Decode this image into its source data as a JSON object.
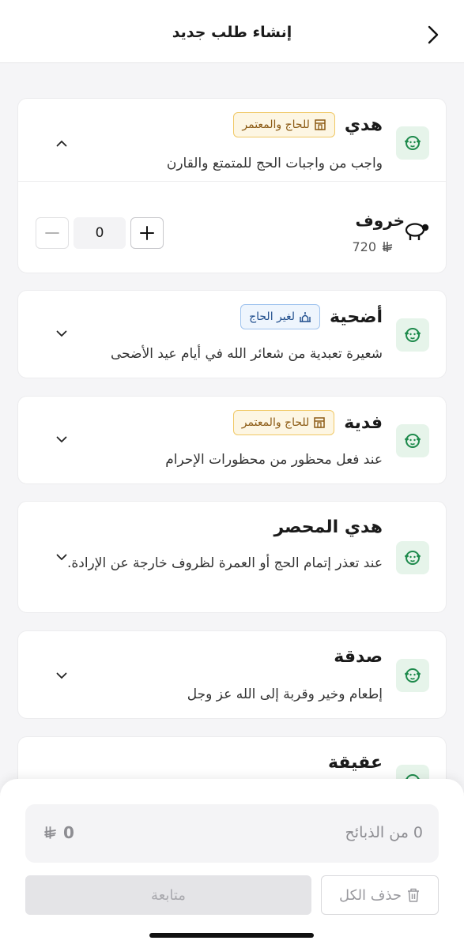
{
  "header": {
    "title": "إنشاء طلب جديد"
  },
  "services": [
    {
      "title": "هدي",
      "badge": "للحاج والمعتمر",
      "description": "واجب من واجبات الحج للمتمتع والقارن",
      "product": {
        "name": "خروف",
        "price": "720",
        "quantity": "0"
      }
    },
    {
      "title": "أضحية",
      "badge": "لغير الحاج",
      "description": "شعيرة تعبدية من شعائر الله في أيام عيد الأضحى"
    },
    {
      "title": "فدية",
      "badge": "للحاج والمعتمر",
      "description": "عند فعل محظور من محظورات الإحرام"
    },
    {
      "title": "هدي المحصر",
      "description": "عند تعذر إتمام الحج أو العمرة لظروف خارجة عن الإرادة."
    },
    {
      "title": "صدقة",
      "description": "إطعام وخير وقربة إلى الله عز وجل"
    },
    {
      "title": "عقيقة"
    }
  ],
  "summary": {
    "count_text": "0 من الذبائح",
    "total": "0"
  },
  "actions": {
    "delete_all": "حذف الكل",
    "continue": "متابعة"
  },
  "colors": {
    "icon_bg": "#e6f4ea",
    "icon_green": "#1e8a4c",
    "amber_badge": "#f0c865",
    "blue_badge": "#9fc3ee"
  }
}
